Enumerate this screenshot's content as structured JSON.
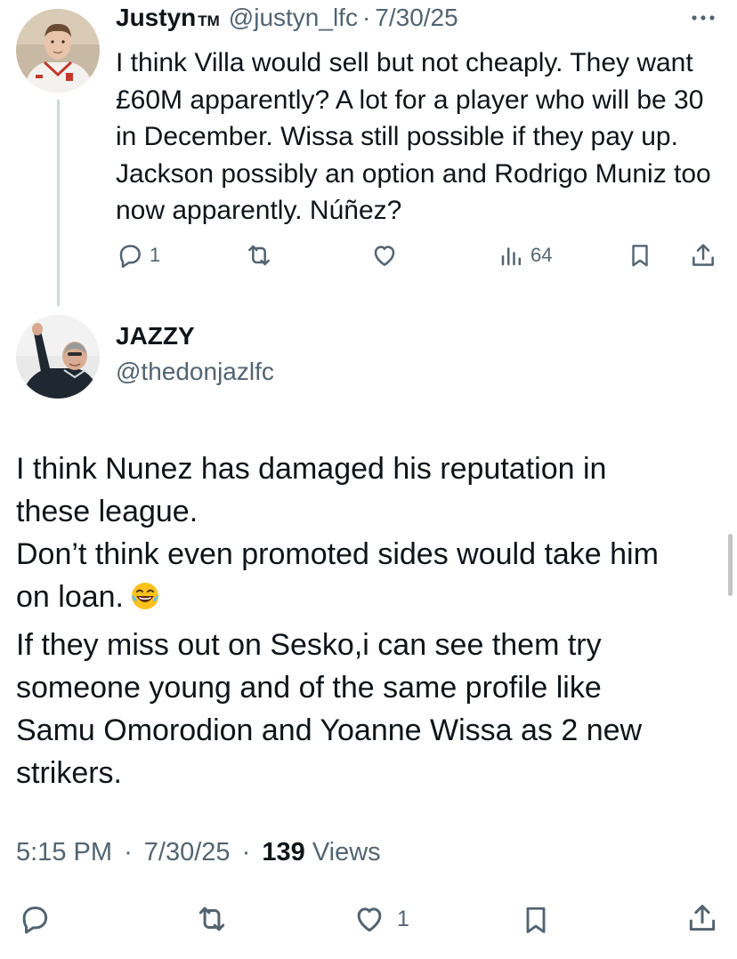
{
  "parent_tweet": {
    "display_name": "Justyn",
    "name_suffix": "TM",
    "handle": "@justyn_lfc",
    "separator": "·",
    "date": "7/30/25",
    "text": "I think Villa would sell but not cheaply. They want £60M apparently? A lot for a player who will be 30 in December. Wissa still possible if they pay up. Jackson possibly an option and Rodrigo Muniz too now apparently. Núñez?",
    "replies": "1",
    "views": "64",
    "icons": [
      "reply-icon",
      "retweet-icon",
      "like-icon",
      "views-icon",
      "bookmark-icon",
      "share-icon",
      "more-icon"
    ]
  },
  "main_tweet": {
    "display_name": "JAZZY",
    "handle": "@thedonjazlfc",
    "lines": [
      "I think Nunez has damaged his reputation in",
      "these league.",
      "Don’t think even promoted sides would take him",
      "on loan.",
      "If they miss out on Sesko,i can see them try",
      "someone young and of the same profile like",
      "Samu Omorodion and Yoanne Wissa as 2 new",
      "strikers."
    ],
    "emoji": "face-with-tears-of-joy",
    "time": "5:15 PM",
    "separator": "·",
    "date": "7/30/25",
    "views_count": "139",
    "views_label": "Views",
    "likes": "1"
  },
  "colors": {
    "text": "#0f1419",
    "secondary": "#536471",
    "thread_line": "#cfd9de"
  }
}
